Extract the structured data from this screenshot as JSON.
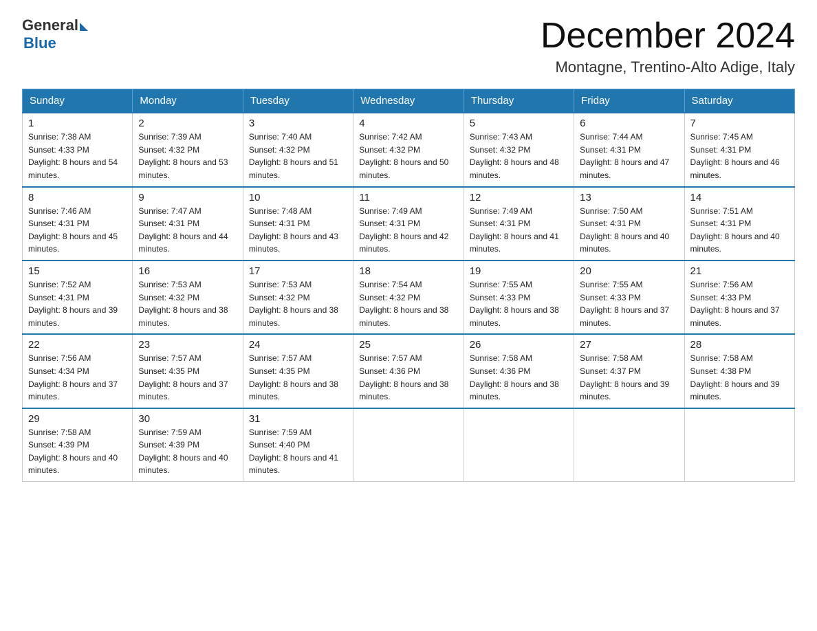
{
  "header": {
    "logo_general": "General",
    "logo_blue": "Blue",
    "month_title": "December 2024",
    "location": "Montagne, Trentino-Alto Adige, Italy"
  },
  "days_of_week": [
    "Sunday",
    "Monday",
    "Tuesday",
    "Wednesday",
    "Thursday",
    "Friday",
    "Saturday"
  ],
  "weeks": [
    [
      {
        "day": "1",
        "sunrise": "7:38 AM",
        "sunset": "4:33 PM",
        "daylight": "8 hours and 54 minutes."
      },
      {
        "day": "2",
        "sunrise": "7:39 AM",
        "sunset": "4:32 PM",
        "daylight": "8 hours and 53 minutes."
      },
      {
        "day": "3",
        "sunrise": "7:40 AM",
        "sunset": "4:32 PM",
        "daylight": "8 hours and 51 minutes."
      },
      {
        "day": "4",
        "sunrise": "7:42 AM",
        "sunset": "4:32 PM",
        "daylight": "8 hours and 50 minutes."
      },
      {
        "day": "5",
        "sunrise": "7:43 AM",
        "sunset": "4:32 PM",
        "daylight": "8 hours and 48 minutes."
      },
      {
        "day": "6",
        "sunrise": "7:44 AM",
        "sunset": "4:31 PM",
        "daylight": "8 hours and 47 minutes."
      },
      {
        "day": "7",
        "sunrise": "7:45 AM",
        "sunset": "4:31 PM",
        "daylight": "8 hours and 46 minutes."
      }
    ],
    [
      {
        "day": "8",
        "sunrise": "7:46 AM",
        "sunset": "4:31 PM",
        "daylight": "8 hours and 45 minutes."
      },
      {
        "day": "9",
        "sunrise": "7:47 AM",
        "sunset": "4:31 PM",
        "daylight": "8 hours and 44 minutes."
      },
      {
        "day": "10",
        "sunrise": "7:48 AM",
        "sunset": "4:31 PM",
        "daylight": "8 hours and 43 minutes."
      },
      {
        "day": "11",
        "sunrise": "7:49 AM",
        "sunset": "4:31 PM",
        "daylight": "8 hours and 42 minutes."
      },
      {
        "day": "12",
        "sunrise": "7:49 AM",
        "sunset": "4:31 PM",
        "daylight": "8 hours and 41 minutes."
      },
      {
        "day": "13",
        "sunrise": "7:50 AM",
        "sunset": "4:31 PM",
        "daylight": "8 hours and 40 minutes."
      },
      {
        "day": "14",
        "sunrise": "7:51 AM",
        "sunset": "4:31 PM",
        "daylight": "8 hours and 40 minutes."
      }
    ],
    [
      {
        "day": "15",
        "sunrise": "7:52 AM",
        "sunset": "4:31 PM",
        "daylight": "8 hours and 39 minutes."
      },
      {
        "day": "16",
        "sunrise": "7:53 AM",
        "sunset": "4:32 PM",
        "daylight": "8 hours and 38 minutes."
      },
      {
        "day": "17",
        "sunrise": "7:53 AM",
        "sunset": "4:32 PM",
        "daylight": "8 hours and 38 minutes."
      },
      {
        "day": "18",
        "sunrise": "7:54 AM",
        "sunset": "4:32 PM",
        "daylight": "8 hours and 38 minutes."
      },
      {
        "day": "19",
        "sunrise": "7:55 AM",
        "sunset": "4:33 PM",
        "daylight": "8 hours and 38 minutes."
      },
      {
        "day": "20",
        "sunrise": "7:55 AM",
        "sunset": "4:33 PM",
        "daylight": "8 hours and 37 minutes."
      },
      {
        "day": "21",
        "sunrise": "7:56 AM",
        "sunset": "4:33 PM",
        "daylight": "8 hours and 37 minutes."
      }
    ],
    [
      {
        "day": "22",
        "sunrise": "7:56 AM",
        "sunset": "4:34 PM",
        "daylight": "8 hours and 37 minutes."
      },
      {
        "day": "23",
        "sunrise": "7:57 AM",
        "sunset": "4:35 PM",
        "daylight": "8 hours and 37 minutes."
      },
      {
        "day": "24",
        "sunrise": "7:57 AM",
        "sunset": "4:35 PM",
        "daylight": "8 hours and 38 minutes."
      },
      {
        "day": "25",
        "sunrise": "7:57 AM",
        "sunset": "4:36 PM",
        "daylight": "8 hours and 38 minutes."
      },
      {
        "day": "26",
        "sunrise": "7:58 AM",
        "sunset": "4:36 PM",
        "daylight": "8 hours and 38 minutes."
      },
      {
        "day": "27",
        "sunrise": "7:58 AM",
        "sunset": "4:37 PM",
        "daylight": "8 hours and 39 minutes."
      },
      {
        "day": "28",
        "sunrise": "7:58 AM",
        "sunset": "4:38 PM",
        "daylight": "8 hours and 39 minutes."
      }
    ],
    [
      {
        "day": "29",
        "sunrise": "7:58 AM",
        "sunset": "4:39 PM",
        "daylight": "8 hours and 40 minutes."
      },
      {
        "day": "30",
        "sunrise": "7:59 AM",
        "sunset": "4:39 PM",
        "daylight": "8 hours and 40 minutes."
      },
      {
        "day": "31",
        "sunrise": "7:59 AM",
        "sunset": "4:40 PM",
        "daylight": "8 hours and 41 minutes."
      },
      null,
      null,
      null,
      null
    ]
  ]
}
